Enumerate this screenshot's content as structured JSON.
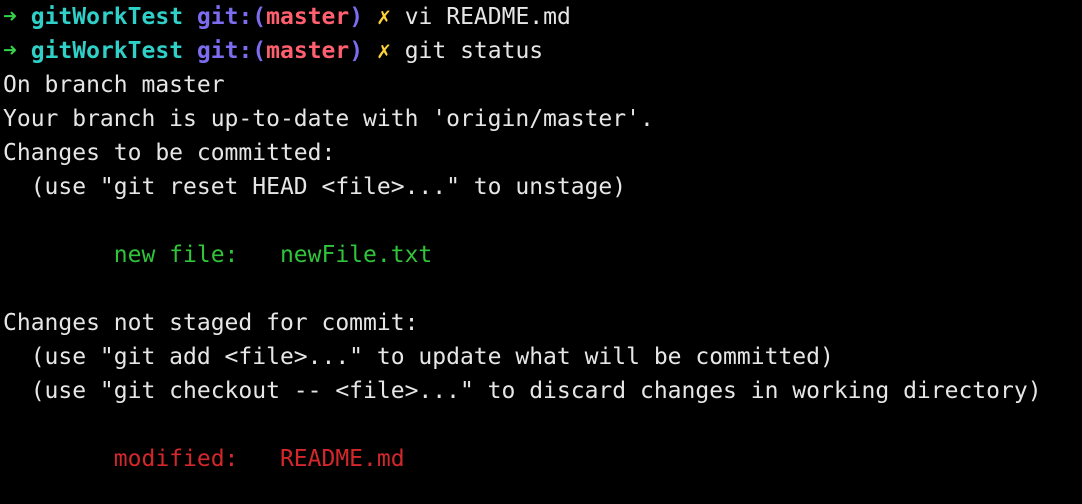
{
  "colors": {
    "background": "#000000",
    "text": "#e6e6e6",
    "prompt_arrow": "#35d24a",
    "prompt_dir": "#2fd0c8",
    "prompt_git": "#7c6cf0",
    "prompt_branch": "#ff5f6e",
    "prompt_dirty": "#ffd23a",
    "staged_file": "#2fc43a",
    "unstaged_file": "#d3272b"
  },
  "prompts": [
    {
      "arrow": "➜",
      "dir": "gitWorkTest",
      "git_prefix": "git:(",
      "branch": "master",
      "git_suffix": ")",
      "dirty": "✗",
      "command": "vi README.md"
    },
    {
      "arrow": "➜",
      "dir": "gitWorkTest",
      "git_prefix": "git:(",
      "branch": "master",
      "git_suffix": ")",
      "dirty": "✗",
      "command": "git status"
    }
  ],
  "output": {
    "on_branch": "On branch master",
    "up_to_date": "Your branch is up-to-date with 'origin/master'.",
    "staged_header": "Changes to be committed:",
    "staged_hint": "  (use \"git reset HEAD <file>...\" to unstage)",
    "staged_file": "        new file:   newFile.txt",
    "unstaged_header": "Changes not staged for commit:",
    "unstaged_hint_1": "  (use \"git add <file>...\" to update what will be committed)",
    "unstaged_hint_2": "  (use \"git checkout -- <file>...\" to discard changes in working directory)",
    "unstaged_file": "        modified:   README.md"
  }
}
